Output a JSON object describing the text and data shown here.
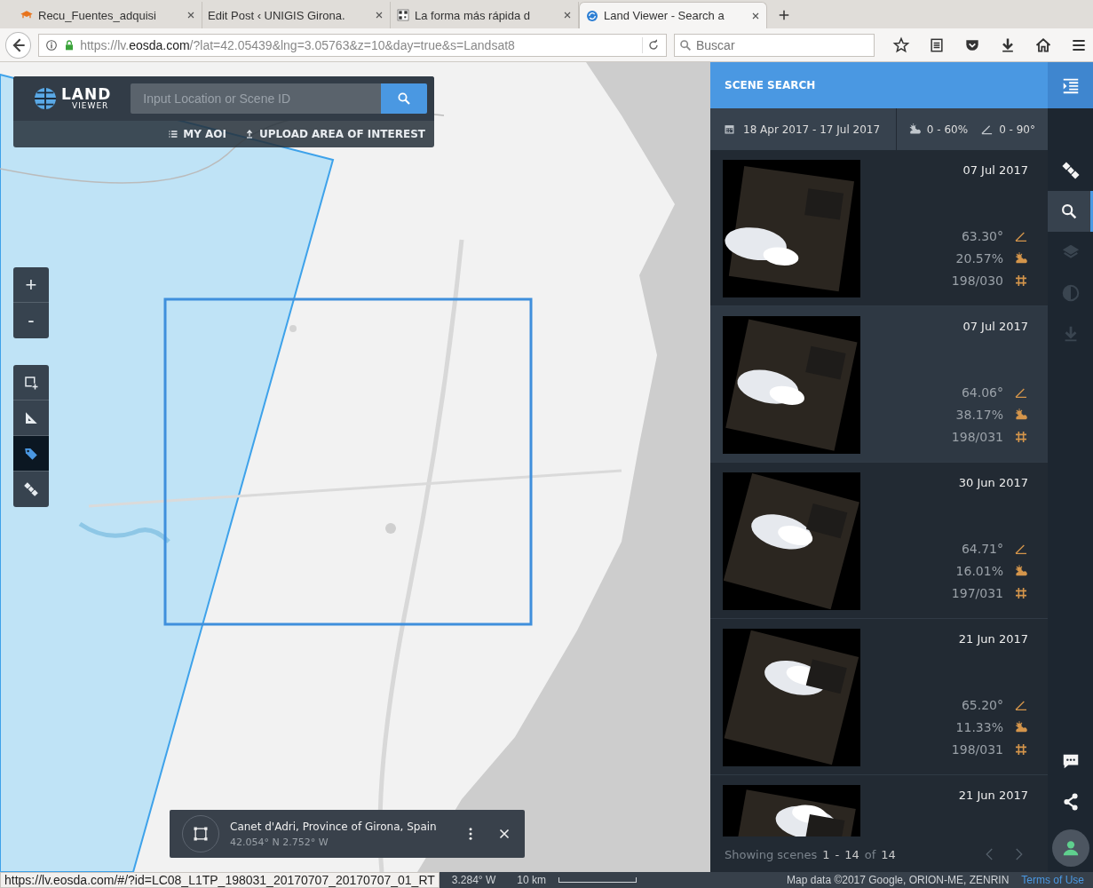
{
  "browser": {
    "tabs": [
      {
        "title": "Recu_Fuentes_adquisi",
        "selected": false
      },
      {
        "title": "Edit Post ‹ UNIGIS Girona.",
        "selected": false
      },
      {
        "title": "La forma más rápida d",
        "selected": false
      },
      {
        "title": "Land Viewer - Search a",
        "selected": true
      }
    ],
    "url_prefix": "https://lv.",
    "url_domain": "eosda.com",
    "url_rest": "/?lat=42.05439&lng=3.05763&z=10&day=true&s=Landsat8",
    "search": {
      "placeholder": "Buscar"
    }
  },
  "header": {
    "logo_main": "LAND",
    "logo_sub": "VIEWER",
    "search": {
      "placeholder": "Input Location or Scene ID"
    },
    "links": [
      {
        "label": "MY AOI"
      },
      {
        "label": "UPLOAD AREA OF INTEREST"
      }
    ]
  },
  "map": {
    "kind": "picture",
    "zoom_buttons": [
      "+",
      "-"
    ],
    "tools": [
      {
        "selected": false
      },
      {
        "selected": false
      },
      {
        "selected": true
      },
      {
        "selected": false
      }
    ],
    "info_card": {
      "title": "Canet d'Adri, Province of Girona, Spain",
      "coords": "42.054° N 2.752° W"
    }
  },
  "panel": {
    "title": "SCENE SEARCH",
    "date_range": "18 Apr 2017 - 17 Jul 2017",
    "cloud_range": "0 - 60%",
    "angle_range": "0 - 90°",
    "scenes": [
      {
        "date": "07 Jul 2017",
        "angle": "63.30°",
        "cloud": "20.57%",
        "path": "198/030",
        "selected": false
      },
      {
        "date": "07 Jul 2017",
        "angle": "64.06°",
        "cloud": "38.17%",
        "path": "198/031",
        "selected": true
      },
      {
        "date": "30 Jun 2017",
        "angle": "64.71°",
        "cloud": "16.01%",
        "path": "197/031",
        "selected": false
      },
      {
        "date": "21 Jun 2017",
        "angle": "65.20°",
        "cloud": "11.33%",
        "path": "198/031",
        "selected": false
      },
      {
        "date": "21 Jun 2017",
        "selected": false
      }
    ],
    "footer": {
      "label": "Showing scenes",
      "from": "1",
      "dash": "-",
      "to": "14",
      "of": "of",
      "total": "14"
    }
  },
  "rail": [
    {
      "selected": false,
      "disabled": false
    },
    {
      "selected": true,
      "disabled": false
    },
    {
      "selected": false,
      "disabled": true
    },
    {
      "selected": false,
      "disabled": true
    },
    {
      "selected": false,
      "disabled": true
    }
  ],
  "status": {
    "link_preview": "https://lv.eosda.com/#/?id=LC08_L1TP_198031_20170707_20170707_01_RT",
    "lng": "3.284° W",
    "scale": "10 km",
    "attribution": "Map data ©2017 Google, ORION-ME, ZENRIN",
    "terms": "Terms of Use"
  }
}
